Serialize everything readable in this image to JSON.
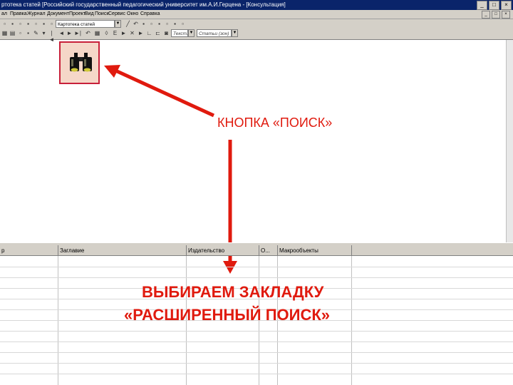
{
  "window": {
    "title": "ртотека статей  [Российский государственный педагогический университет им.А.И.Герцена - [Консультация]",
    "buttons": [
      "_",
      "□",
      "×"
    ]
  },
  "menu": {
    "items": [
      "ал",
      "Правка",
      "Журнал",
      "Документ",
      "Проект",
      "Вид",
      "Поиск",
      "Сервис",
      "Окно",
      "Справка"
    ],
    "mdi_buttons": [
      "_",
      "□",
      "×"
    ]
  },
  "toolbar": {
    "catalog_combo": "Картотека статей",
    "text_material_combo": "Текст. материал",
    "articles_combo": "Статьи (зон)"
  },
  "annotations": {
    "search_button_label": "КНОПКА «ПОИСК»",
    "advanced_line1": "ВЫБИРАЕМ ЗАКЛАДКУ",
    "advanced_line2": "«РАСШИРЕННЫЙ ПОИСК»",
    "color": "#e01a0e"
  },
  "grid": {
    "columns": [
      "р",
      "Заглавие",
      "Издательство",
      "О...",
      "Макрообъекты"
    ]
  },
  "icons": {
    "search": "binoculars-icon",
    "arrow": "red-arrow"
  }
}
